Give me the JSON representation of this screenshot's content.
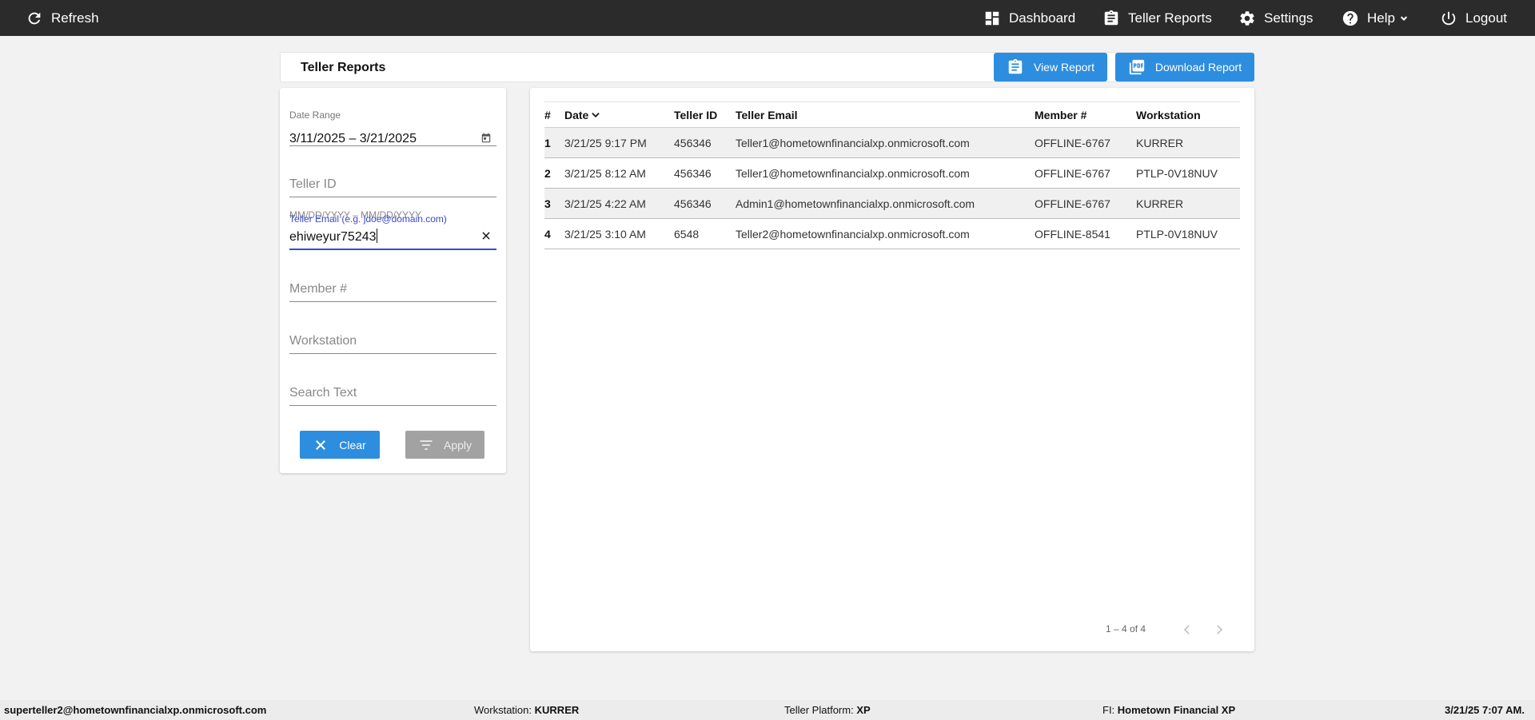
{
  "topbar": {
    "refresh_label": "Refresh",
    "nav": {
      "dashboard": "Dashboard",
      "teller_reports": "Teller Reports",
      "settings": "Settings",
      "help": "Help",
      "logout": "Logout"
    }
  },
  "header": {
    "title": "Teller Reports",
    "view_report_label": "View Report",
    "download_report_label": "Download Report"
  },
  "filters": {
    "date_range": {
      "label": "Date Range",
      "value": "3/11/2025 – 3/21/2025",
      "hint": "MM/DD/YYYY – MM/DD/YYYY"
    },
    "teller_id": {
      "placeholder": "Teller ID"
    },
    "teller_email": {
      "label": "Teller Email (e.g. jdoe@domain.com)",
      "value": "ehiweyur75243"
    },
    "member": {
      "placeholder": "Member #"
    },
    "workstation": {
      "placeholder": "Workstation"
    },
    "search_text": {
      "placeholder": "Search Text"
    },
    "clear_label": "Clear",
    "apply_label": "Apply"
  },
  "table": {
    "columns": {
      "num": "#",
      "date": "Date",
      "teller_id": "Teller ID",
      "teller_email": "Teller Email",
      "member": "Member #",
      "workstation": "Workstation"
    },
    "rows": [
      {
        "num": "1",
        "date": "3/21/25 9:17 PM",
        "teller_id": "456346",
        "teller_email": "Teller1@hometownfinancialxp.onmicrosoft.com",
        "member": "OFFLINE-6767",
        "workstation": "KURRER"
      },
      {
        "num": "2",
        "date": "3/21/25 8:12 AM",
        "teller_id": "456346",
        "teller_email": "Teller1@hometownfinancialxp.onmicrosoft.com",
        "member": "OFFLINE-6767",
        "workstation": "PTLP-0V18NUV"
      },
      {
        "num": "3",
        "date": "3/21/25 4:22 AM",
        "teller_id": "456346",
        "teller_email": "Admin1@hometownfinancialxp.onmicrosoft.com",
        "member": "OFFLINE-6767",
        "workstation": "KURRER"
      },
      {
        "num": "4",
        "date": "3/21/25 3:10 AM",
        "teller_id": "6548",
        "teller_email": "Teller2@hometownfinancialxp.onmicrosoft.com",
        "member": "OFFLINE-8541",
        "workstation": "PTLP-0V18NUV"
      }
    ],
    "pagination": "1 – 4 of 4"
  },
  "footer": {
    "user": "superteller2@hometownfinancialxp.onmicrosoft.com",
    "workstation_label": "Workstation:",
    "workstation_value": "KURRER",
    "platform_label": "Teller Platform:",
    "platform_value": "XP",
    "fi_label": "FI:",
    "fi_value": "Hometown Financial XP",
    "datetime": "3/21/25 7:07 AM."
  },
  "colors": {
    "topbar": "#2b2b2b",
    "accent_blue": "#2d8ddf",
    "focus_indigo": "#3a4ad0",
    "disabled_gray": "#a2a2a2"
  }
}
